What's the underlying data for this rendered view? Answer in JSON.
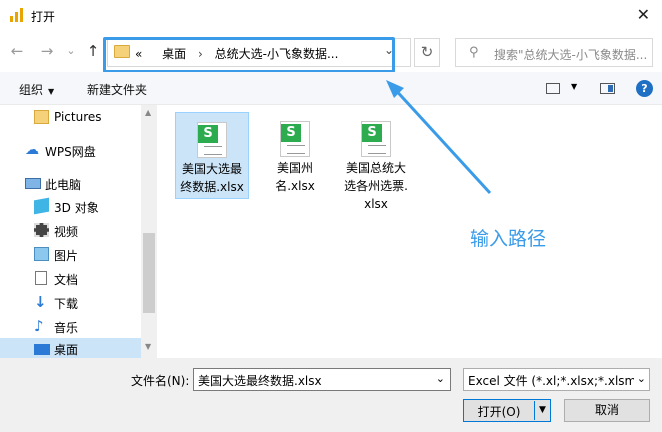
{
  "window": {
    "title": "打开",
    "close_label": "✕"
  },
  "nav": {
    "back": "←",
    "forward": "→",
    "recent": "⌄",
    "up": "↑",
    "breadcrumb": {
      "prefix": "«",
      "items": [
        "桌面",
        "总统大选-小飞象数据..."
      ],
      "separator": "›"
    },
    "refresh": "↻",
    "search_placeholder": "搜索\"总统大选-小飞象数据..."
  },
  "toolbar": {
    "organize": "组织",
    "new_folder": "新建文件夹",
    "help": "?"
  },
  "sidebar": {
    "items": [
      {
        "label": "Pictures",
        "icon": "folder-icon"
      },
      {
        "label": "WPS网盘",
        "icon": "cloud-icon"
      },
      {
        "label": "此电脑",
        "icon": "computer-icon"
      },
      {
        "label": "3D 对象",
        "icon": "cube-icon"
      },
      {
        "label": "视频",
        "icon": "video-icon"
      },
      {
        "label": "图片",
        "icon": "picture-icon"
      },
      {
        "label": "文档",
        "icon": "document-icon"
      },
      {
        "label": "下载",
        "icon": "download-icon"
      },
      {
        "label": "音乐",
        "icon": "music-icon"
      },
      {
        "label": "桌面",
        "icon": "desktop-icon"
      }
    ]
  },
  "files": [
    {
      "name": "美国大选最终数据.xlsx",
      "icon_letter": "S",
      "selected": true
    },
    {
      "name": "美国州名.xlsx",
      "icon_letter": "S",
      "selected": false
    },
    {
      "name": "美国总统大选各州选票.xlsx",
      "icon_letter": "S",
      "selected": false
    }
  ],
  "annotation": {
    "text": "输入路径",
    "color": "#3a9be8"
  },
  "bottom": {
    "filename_label": "文件名(N):",
    "filename_value": "美国大选最终数据.xlsx",
    "filter_value": "Excel 文件 (*.xl;*.xlsx;*.xlsm;*.xlsb;*.xls)",
    "open_label": "打开(O)",
    "cancel_label": "取消"
  },
  "colors": {
    "accent": "#0078d7",
    "selection": "#cce4f7",
    "excel_green": "#2dab4f"
  }
}
